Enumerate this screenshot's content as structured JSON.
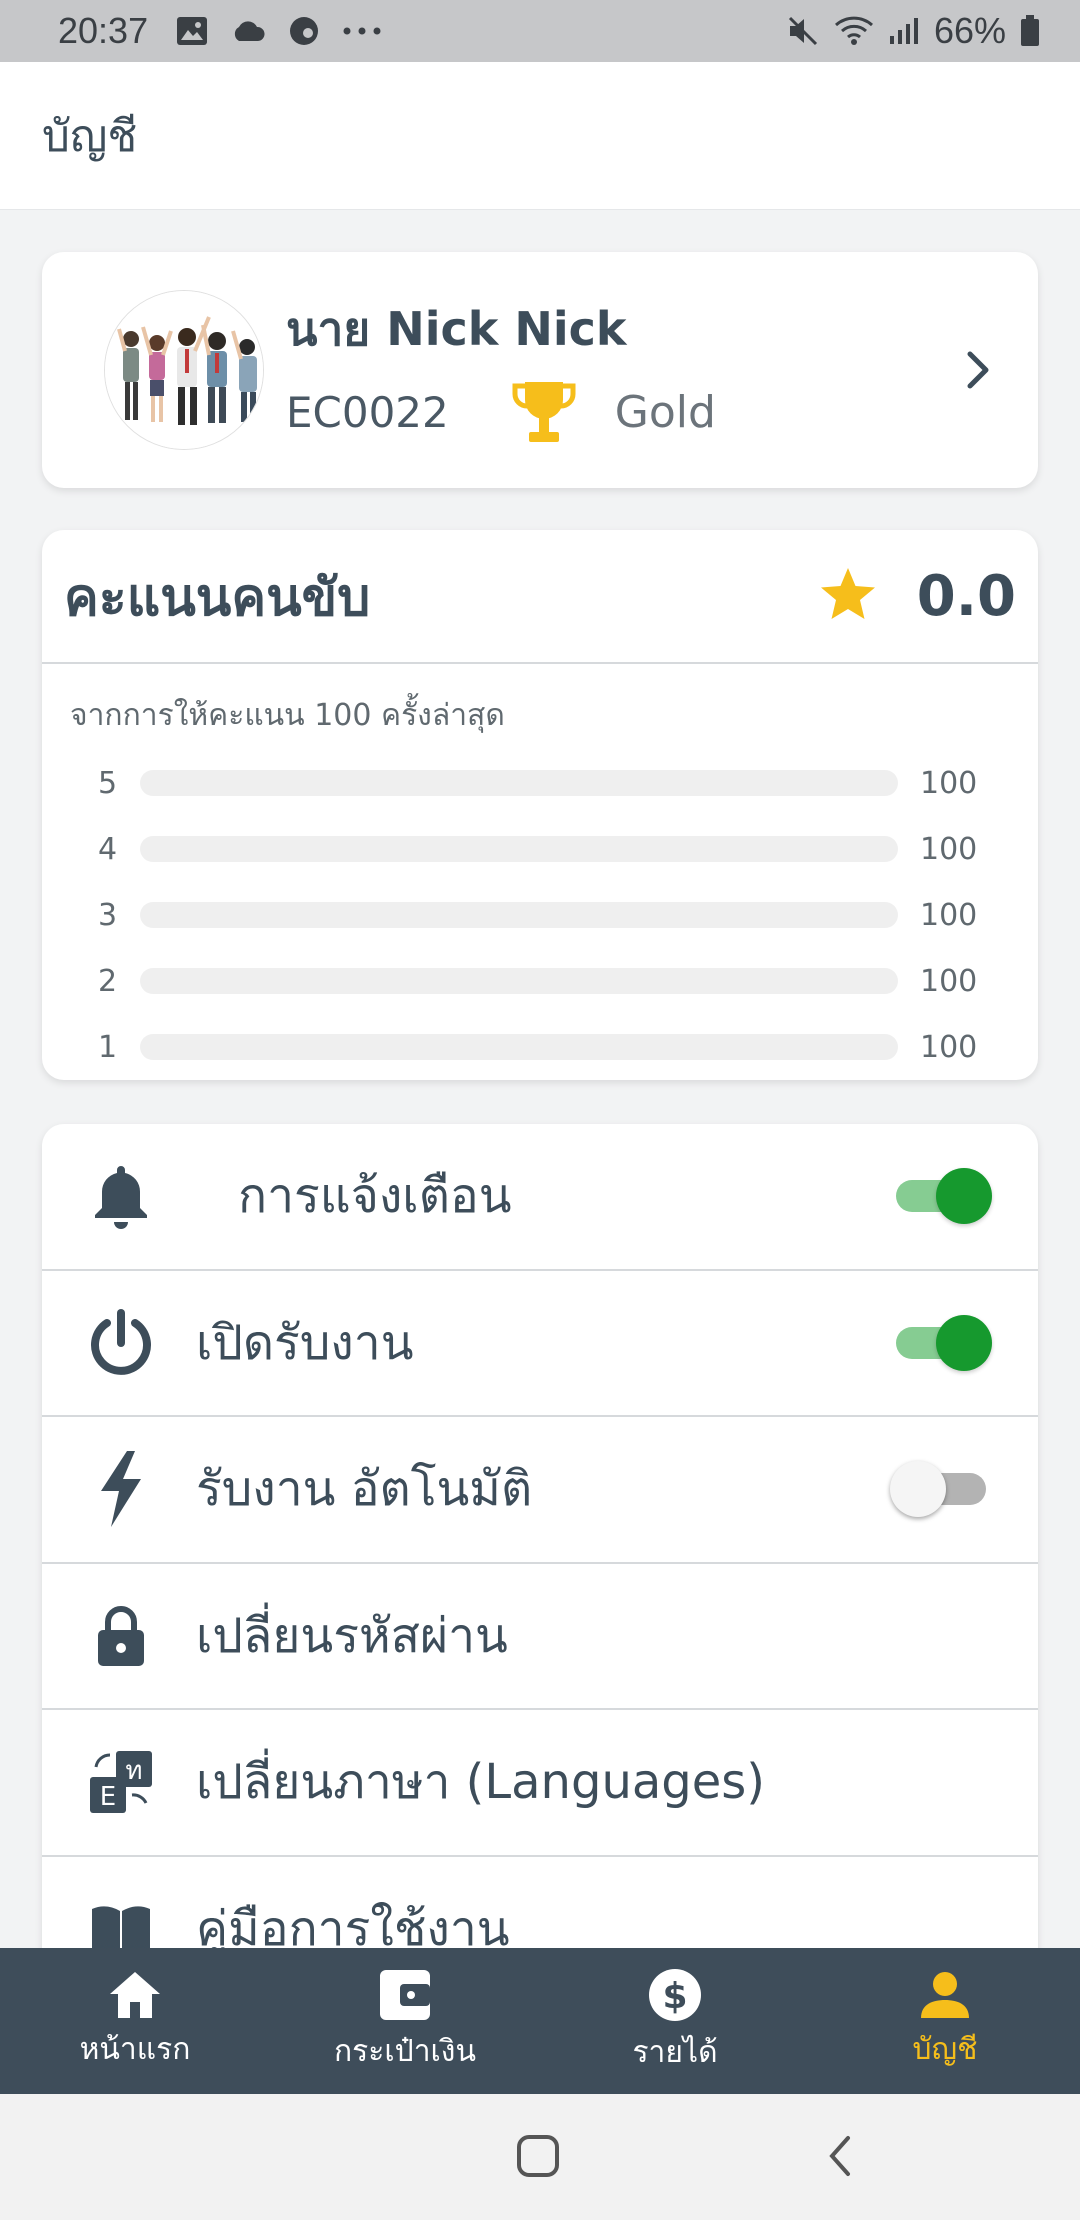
{
  "status_bar": {
    "time": "20:37",
    "battery": "66%",
    "icons": [
      "image-icon",
      "cloud-icon",
      "app-icon",
      "more-dots-icon",
      "mute-icon",
      "wifi-icon",
      "signal-icon",
      "battery-icon"
    ]
  },
  "app_bar": {
    "title": "บัญชี"
  },
  "profile": {
    "name": "นาย Nick Nick",
    "id": "EC0022",
    "tier": "Gold",
    "trophy_color": "#f6be1b"
  },
  "rating": {
    "title": "คะแนนคนขับ",
    "score": "0.0",
    "subtitle": "จากการให้คะแนน 100 ครั้งล่าสุด",
    "star_color": "#f6be1b",
    "bars": [
      {
        "label": "5",
        "value": "100",
        "fill": 0
      },
      {
        "label": "4",
        "value": "100",
        "fill": 0
      },
      {
        "label": "3",
        "value": "100",
        "fill": 0
      },
      {
        "label": "2",
        "value": "100",
        "fill": 0
      },
      {
        "label": "1",
        "value": "100",
        "fill": 0
      }
    ]
  },
  "settings": {
    "notifications": {
      "label": "การแจ้งเตือน",
      "on": true
    },
    "accept_jobs": {
      "label": "เปิดรับงาน",
      "on": true
    },
    "auto_accept": {
      "label": "รับงาน อัตโนมัติ",
      "on": false
    },
    "change_password": {
      "label": "เปลี่ยนรหัสผ่าน"
    },
    "change_language": {
      "label": "เปลี่ยนภาษา (Languages)"
    },
    "manual": {
      "label": "คู่มือการใช้งาน"
    }
  },
  "bottom_nav": {
    "items": [
      {
        "label": "หน้าแรก",
        "icon": "home-icon"
      },
      {
        "label": "กระเป๋าเงิน",
        "icon": "wallet-icon"
      },
      {
        "label": "รายได้",
        "icon": "dollar-icon"
      },
      {
        "label": "บัญชี",
        "icon": "person-icon",
        "active": true
      }
    ],
    "active_color": "#f6be1b",
    "background": "#3e4d5a"
  },
  "toggle_colors": {
    "on_knob": "#16992e",
    "on_track": "#86cc92",
    "off_track": "#b3b3b3"
  }
}
